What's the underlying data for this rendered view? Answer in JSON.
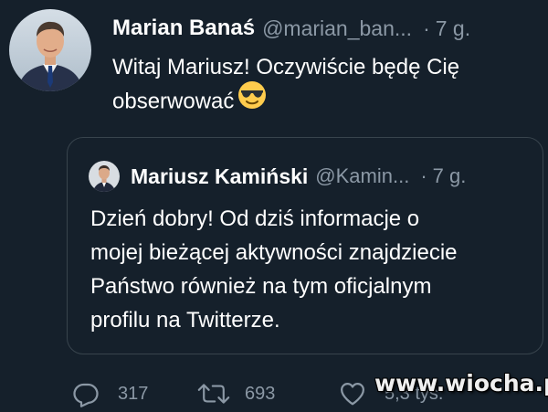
{
  "tweet": {
    "author_name": "Marian Banaś",
    "author_handle": "@marian_ban...",
    "separator": "·",
    "time": "7 g.",
    "text_line1": "Witaj Mariusz! Oczywiście będę Cię",
    "text_line2": "obserwować",
    "emoji_icon": "sunglasses-face-icon"
  },
  "quoted_tweet": {
    "author_name": "Mariusz Kamiński",
    "author_handle": "@Kamin...",
    "separator": "·",
    "time": "7 g.",
    "lines": [
      "Dzień dobry! Od dziś informacje o",
      "mojej bieżącej aktywności znajdziecie",
      "Państwo również na tym oficjalnym",
      "profilu na Twitterze."
    ]
  },
  "actions": {
    "reply_count": "317",
    "retweet_count": "693",
    "like_count": "5,3 tys."
  },
  "watermark": "www.wiocha.pl",
  "colors": {
    "background": "#15202b",
    "secondary_text": "#8b98a5",
    "border": "#38444d"
  }
}
